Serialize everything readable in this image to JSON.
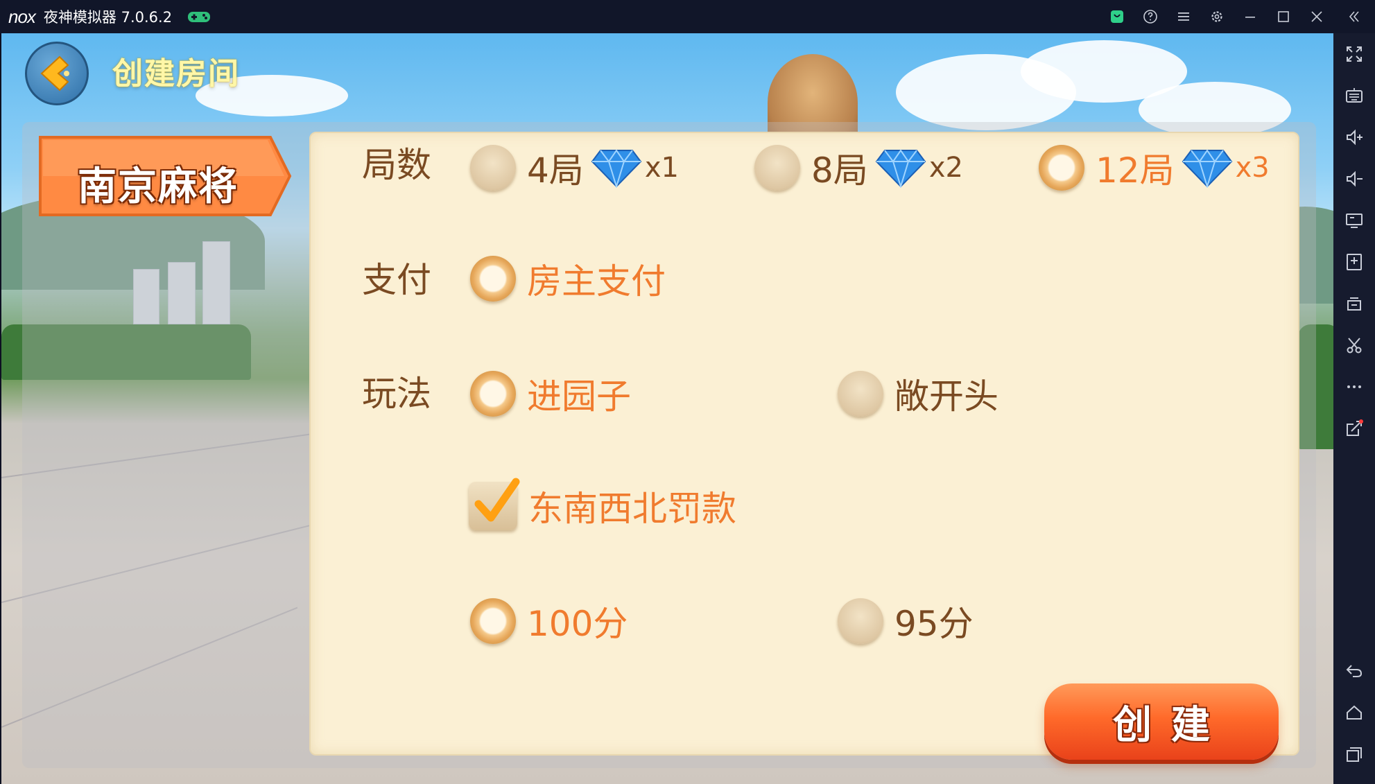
{
  "window": {
    "brand": "nox",
    "title": "夜神模拟器 7.0.6.2",
    "title_icons": [
      "store-icon",
      "help-icon",
      "menu-icon",
      "settings-icon",
      "minimize-icon",
      "maximize-icon",
      "close-icon",
      "collapse-sidebar-icon"
    ]
  },
  "sidebar": {
    "icons": [
      "fullscreen-icon",
      "keyboard-icon",
      "volume-up-icon",
      "volume-down-icon",
      "screen-icon",
      "apk-install-icon",
      "multi-instance-icon",
      "scissors-icon",
      "more-icon",
      "share-icon",
      "back-icon",
      "home-icon",
      "recent-apps-icon"
    ]
  },
  "game": {
    "page_title": "创建房间",
    "tab_label": "南京麻将",
    "rounds": {
      "label": "局数",
      "options": [
        {
          "label": "4局",
          "multiplier": "x1",
          "selected": false
        },
        {
          "label": "8局",
          "multiplier": "x2",
          "selected": false
        },
        {
          "label": "12局",
          "multiplier": "x3",
          "selected": true
        }
      ]
    },
    "payment": {
      "label": "支付",
      "options": [
        {
          "label": "房主支付",
          "selected": true
        }
      ]
    },
    "gameplay": {
      "label": "玩法",
      "options": [
        {
          "label": "进园子",
          "selected": true
        },
        {
          "label": "敞开头",
          "selected": false
        }
      ],
      "checkbox": {
        "label": "东南西北罚款",
        "checked": true
      },
      "score_options": [
        {
          "label": "100分",
          "selected": true
        },
        {
          "label": "95分",
          "selected": false
        }
      ]
    },
    "create_button": "创建"
  },
  "colors": {
    "label_brown": "#7a4a22",
    "selected_orange": "#f07b2e",
    "card_bg": "#fbf0d4",
    "button_orange": "#ff6a2a"
  }
}
